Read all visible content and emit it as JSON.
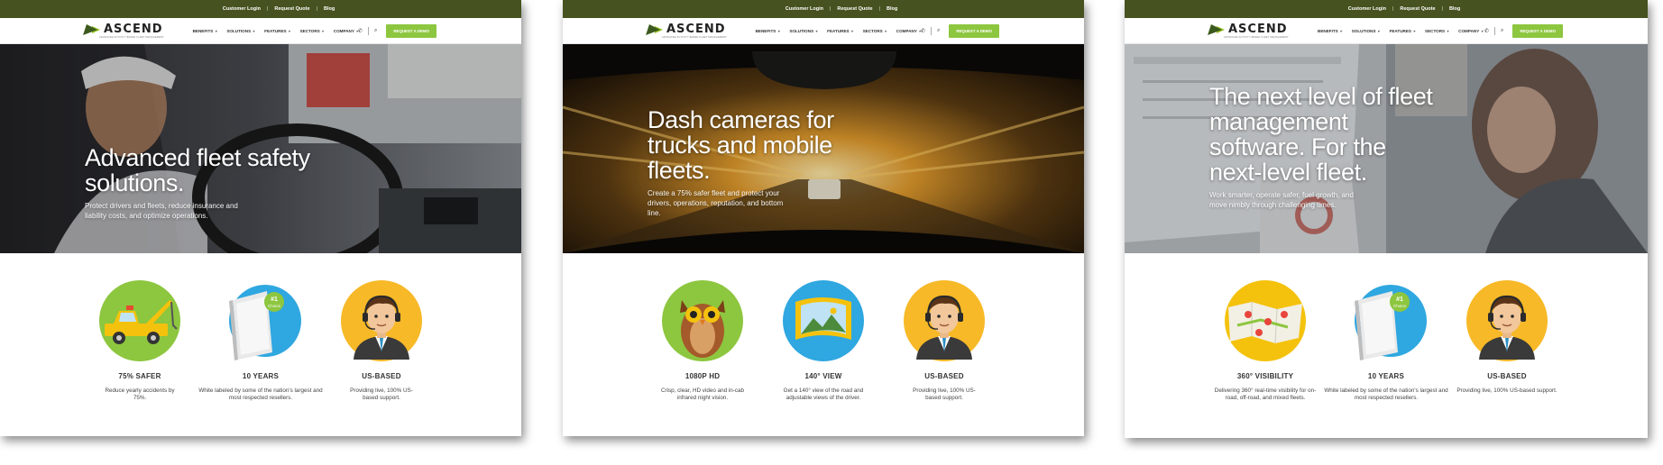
{
  "brand": {
    "name": "ASCEND",
    "tagline": "ADVANCED ACTIVITY-BASED FLEET MANAGEMENT",
    "accent_color": "#8dc63f",
    "topbar_color": "#46521f"
  },
  "topbar": {
    "customer_login": "Customer Login",
    "request_quote": "Request Quote",
    "blog": "Blog",
    "separator": "|"
  },
  "nav": {
    "items": [
      "BENEFITS",
      "SOLUTIONS",
      "FEATURES",
      "SECTORS",
      "COMPANY"
    ],
    "demo_button": "REQUEST A DEMO",
    "icons": [
      "phone-icon",
      "search-icon"
    ]
  },
  "panels": [
    {
      "hero_title": "Advanced fleet safety solutions.",
      "hero_subtitle": "Protect drivers and fleets, reduce insurance and liability costs, and optimize operations.",
      "features": [
        {
          "icon": "tow-truck-icon",
          "title": "75% SAFER",
          "desc": "Reduce yearly accidents by 75%."
        },
        {
          "icon": "binder-badge-icon",
          "title": "10 YEARS",
          "desc": "White labeled by some of the nation's largest and most respected resellers."
        },
        {
          "icon": "support-agent-icon",
          "title": "US-BASED",
          "desc": "Providing live, 100% US-based support."
        }
      ]
    },
    {
      "hero_title": "Dash cameras for trucks and mobile fleets.",
      "hero_subtitle": "Create a 75% safer fleet and protect your drivers, operations, reputation, and bottom line.",
      "features": [
        {
          "icon": "owl-icon",
          "title": "1080P HD",
          "desc": "Crisp, clear, HD video and in-cab infrared night vision."
        },
        {
          "icon": "panorama-view-icon",
          "title": "140° VIEW",
          "desc": "Get a 140° view of the road and adjustable views of the driver."
        },
        {
          "icon": "support-agent-icon",
          "title": "US-BASED",
          "desc": "Providing live, 100% US-based support."
        }
      ]
    },
    {
      "hero_title": "The next level of fleet management software. For the next-level fleet.",
      "hero_subtitle": "Work smarter, operate safer, fuel growth, and move nimbly through challenging times.",
      "features": [
        {
          "icon": "map-pins-icon",
          "title": "360° VISIBILITY",
          "desc": "Delivering 360° real-time visibility for on-road, off-road, and mixed fleets."
        },
        {
          "icon": "binder-badge-icon",
          "title": "10 YEARS",
          "desc": "White labeled by some of the nation's largest and most respected resellers."
        },
        {
          "icon": "support-agent-icon",
          "title": "US-BASED",
          "desc": "Providing live, 100% US-based support."
        }
      ]
    }
  ],
  "badge": {
    "line1": "#1",
    "line2": "Choice"
  }
}
